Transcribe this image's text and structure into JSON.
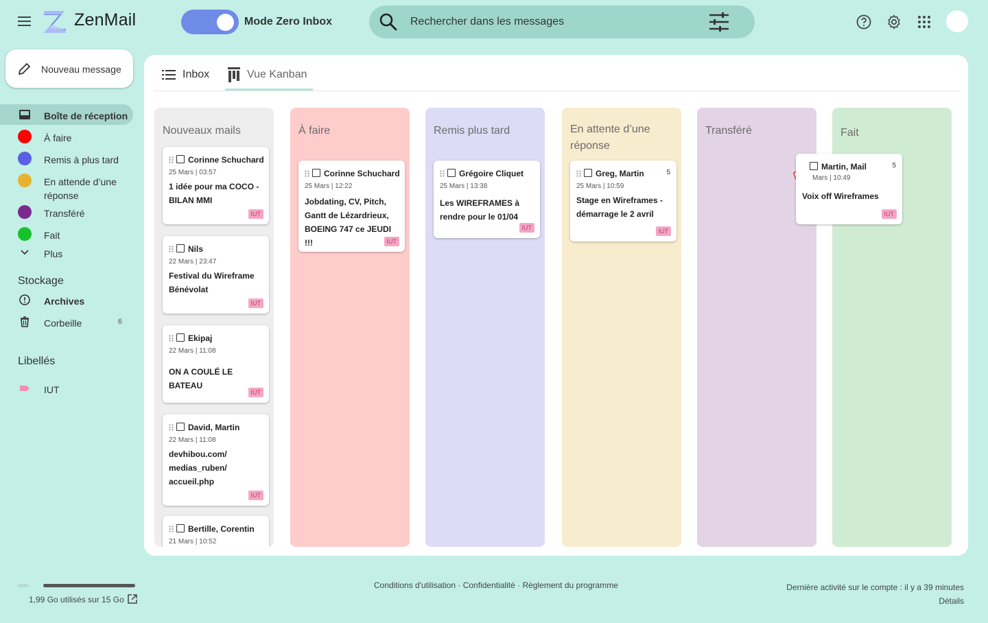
{
  "header": {
    "app_name": "ZenMail",
    "zero_inbox_label": "Mode Zero Inbox",
    "zero_inbox_on": true,
    "search_placeholder": "Rechercher dans les messages"
  },
  "sidebar": {
    "compose_label": "Nouveau message",
    "items": [
      {
        "label": "Boîte de réception",
        "active": true
      },
      {
        "label": "À faire",
        "color": "#ff0000"
      },
      {
        "label": "Remis à plus tard",
        "color": "#5b5fe6"
      },
      {
        "label": "En attende d’une réponse",
        "color": "#e8b22e"
      },
      {
        "label": "Transféré",
        "color": "#7b2b8f"
      },
      {
        "label": "Fait",
        "color": "#16c12b"
      },
      {
        "label": "Plus"
      }
    ],
    "storage_title": "Stockage",
    "storage_items": [
      {
        "label": "Archives"
      },
      {
        "label": "Corbeille",
        "count": "6"
      }
    ],
    "labels_title": "Libellés",
    "labels": [
      {
        "label": "IUT",
        "color": "#f48fb1"
      }
    ]
  },
  "tabs": [
    {
      "label": "Inbox"
    },
    {
      "label": "Vue Kanban",
      "selected": true
    }
  ],
  "columns": [
    {
      "title": "Nouveaux mails",
      "bg": "#eeeeee",
      "cards": [
        {
          "sender": "Corinne Schuchard",
          "date": "25 Mars | 03:57",
          "subject": "1 idée pour ma COCO - BILAN MMI",
          "tag": "IUT"
        },
        {
          "sender": "Nils",
          "date": "22 Mars | 23:47",
          "subject": "Festival du Wireframe Bénévolat",
          "tag": "IUT"
        },
        {
          "sender": "Ekipaj",
          "date": "22 Mars | 11:08",
          "subject": "ON A COULÉ LE BATEAU",
          "tag": "IUT"
        },
        {
          "sender": "David, Martin",
          "date": "22 Mars | 11:08",
          "subject": "devhibou.com/ medias_ruben/ accueil.php",
          "tag": "IUT"
        },
        {
          "sender": "Bertille, Corentin",
          "date": "21 Mars | 10:52",
          "subject": "",
          "tag": ""
        }
      ]
    },
    {
      "title": "À faire",
      "bg": "#ffcccc",
      "cards": [
        {
          "sender": "Corinne Schuchard",
          "date": "25 Mars | 12:22",
          "subject": "Jobdating, CV, Pitch, Gantt de Lézardrieux, BOEING 747 ce JEUDI !!!",
          "tag": "IUT"
        }
      ]
    },
    {
      "title": "Remis plus tard",
      "bg": "#dcdcf6",
      "cards": [
        {
          "sender": "Grégoire Cliquet",
          "date": "25 Mars | 13:38",
          "subject": "Les WIREFRAMES à rendre pour le 01/04",
          "tag": "IUT"
        }
      ]
    },
    {
      "title": "En attente d’une réponse",
      "bg": "#f8ecce",
      "cards": [
        {
          "sender": "Greg, Martin",
          "count": "5",
          "date": "25 Mars | 10:59",
          "subject": "Stage en Wireframes - démarrage le 2 avril",
          "tag": "IUT"
        }
      ]
    },
    {
      "title": "Transféré",
      "bg": "#e2d4e4",
      "cards": []
    },
    {
      "title": "Fait",
      "bg": "#cfecd3",
      "cards": []
    }
  ],
  "dragged_card": {
    "sender": "Martin, Mail",
    "count": "5",
    "date": "Mars | 10:49",
    "subject": "Voix off Wireframes",
    "tag": "IUT"
  },
  "footer": {
    "storage_text": "1,99 Go utilisés sur 15 Go",
    "storage_used_fraction": 0.133,
    "link_terms": "Conditions d'utilisation",
    "link_privacy": "Confidentialité",
    "link_rules": "Règlement du programme",
    "activity": "Dernière activité sur le compte : il y a 39 minutes",
    "details": "Détails"
  }
}
